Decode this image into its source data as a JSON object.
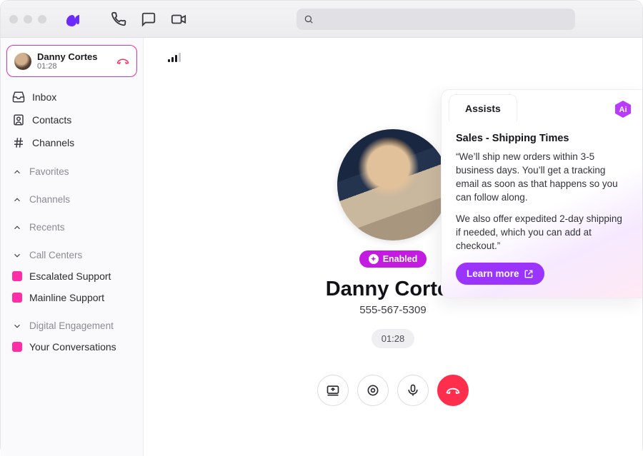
{
  "active_call": {
    "name": "Danny Cortes",
    "duration": "01:28"
  },
  "sidebar": {
    "nav": [
      {
        "icon": "inbox",
        "label": "Inbox"
      },
      {
        "icon": "contacts",
        "label": "Contacts"
      },
      {
        "icon": "hash",
        "label": "Channels"
      }
    ],
    "sections": {
      "favorites": "Favorites",
      "channels": "Channels",
      "recents": "Recents",
      "call_centers": "Call Centers",
      "digital_engagement": "Digital Engagement"
    },
    "call_center_items": [
      "Escalated Support",
      "Mainline Support"
    ],
    "digital_items": [
      "Your Conversations"
    ]
  },
  "call": {
    "enabled_label": "Enabled",
    "name": "Danny Cortes",
    "phone": "555-567-5309",
    "duration": "01:28"
  },
  "assist": {
    "tab_label": "Assists",
    "card_title": "Sales - Shipping Times",
    "paragraph1": "“We’ll ship new orders within 3-5 business days. You’ll get a tracking email as soon as that happens so you can follow along.",
    "paragraph2": "We also offer expedited 2-day shipping if needed, which you can add at checkout.”",
    "learn_more": "Learn more"
  }
}
